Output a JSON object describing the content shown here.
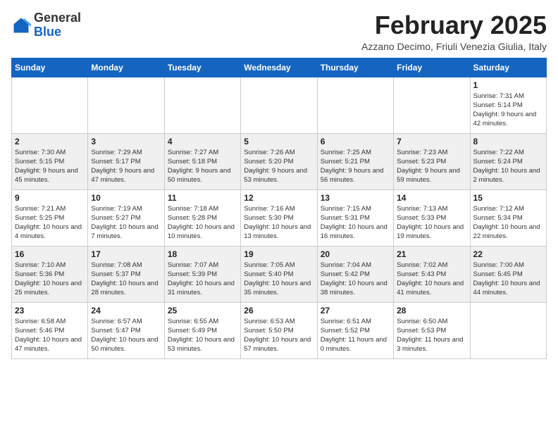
{
  "header": {
    "logo_line1": "General",
    "logo_line2": "Blue",
    "month_year": "February 2025",
    "location": "Azzano Decimo, Friuli Venezia Giulia, Italy"
  },
  "days_of_week": [
    "Sunday",
    "Monday",
    "Tuesday",
    "Wednesday",
    "Thursday",
    "Friday",
    "Saturday"
  ],
  "weeks": [
    [
      {
        "day": "",
        "info": ""
      },
      {
        "day": "",
        "info": ""
      },
      {
        "day": "",
        "info": ""
      },
      {
        "day": "",
        "info": ""
      },
      {
        "day": "",
        "info": ""
      },
      {
        "day": "",
        "info": ""
      },
      {
        "day": "1",
        "info": "Sunrise: 7:31 AM\nSunset: 5:14 PM\nDaylight: 9 hours and 42 minutes."
      }
    ],
    [
      {
        "day": "2",
        "info": "Sunrise: 7:30 AM\nSunset: 5:15 PM\nDaylight: 9 hours and 45 minutes."
      },
      {
        "day": "3",
        "info": "Sunrise: 7:29 AM\nSunset: 5:17 PM\nDaylight: 9 hours and 47 minutes."
      },
      {
        "day": "4",
        "info": "Sunrise: 7:27 AM\nSunset: 5:18 PM\nDaylight: 9 hours and 50 minutes."
      },
      {
        "day": "5",
        "info": "Sunrise: 7:26 AM\nSunset: 5:20 PM\nDaylight: 9 hours and 53 minutes."
      },
      {
        "day": "6",
        "info": "Sunrise: 7:25 AM\nSunset: 5:21 PM\nDaylight: 9 hours and 56 minutes."
      },
      {
        "day": "7",
        "info": "Sunrise: 7:23 AM\nSunset: 5:23 PM\nDaylight: 9 hours and 59 minutes."
      },
      {
        "day": "8",
        "info": "Sunrise: 7:22 AM\nSunset: 5:24 PM\nDaylight: 10 hours and 2 minutes."
      }
    ],
    [
      {
        "day": "9",
        "info": "Sunrise: 7:21 AM\nSunset: 5:25 PM\nDaylight: 10 hours and 4 minutes."
      },
      {
        "day": "10",
        "info": "Sunrise: 7:19 AM\nSunset: 5:27 PM\nDaylight: 10 hours and 7 minutes."
      },
      {
        "day": "11",
        "info": "Sunrise: 7:18 AM\nSunset: 5:28 PM\nDaylight: 10 hours and 10 minutes."
      },
      {
        "day": "12",
        "info": "Sunrise: 7:16 AM\nSunset: 5:30 PM\nDaylight: 10 hours and 13 minutes."
      },
      {
        "day": "13",
        "info": "Sunrise: 7:15 AM\nSunset: 5:31 PM\nDaylight: 10 hours and 16 minutes."
      },
      {
        "day": "14",
        "info": "Sunrise: 7:13 AM\nSunset: 5:33 PM\nDaylight: 10 hours and 19 minutes."
      },
      {
        "day": "15",
        "info": "Sunrise: 7:12 AM\nSunset: 5:34 PM\nDaylight: 10 hours and 22 minutes."
      }
    ],
    [
      {
        "day": "16",
        "info": "Sunrise: 7:10 AM\nSunset: 5:36 PM\nDaylight: 10 hours and 25 minutes."
      },
      {
        "day": "17",
        "info": "Sunrise: 7:08 AM\nSunset: 5:37 PM\nDaylight: 10 hours and 28 minutes."
      },
      {
        "day": "18",
        "info": "Sunrise: 7:07 AM\nSunset: 5:39 PM\nDaylight: 10 hours and 31 minutes."
      },
      {
        "day": "19",
        "info": "Sunrise: 7:05 AM\nSunset: 5:40 PM\nDaylight: 10 hours and 35 minutes."
      },
      {
        "day": "20",
        "info": "Sunrise: 7:04 AM\nSunset: 5:42 PM\nDaylight: 10 hours and 38 minutes."
      },
      {
        "day": "21",
        "info": "Sunrise: 7:02 AM\nSunset: 5:43 PM\nDaylight: 10 hours and 41 minutes."
      },
      {
        "day": "22",
        "info": "Sunrise: 7:00 AM\nSunset: 5:45 PM\nDaylight: 10 hours and 44 minutes."
      }
    ],
    [
      {
        "day": "23",
        "info": "Sunrise: 6:58 AM\nSunset: 5:46 PM\nDaylight: 10 hours and 47 minutes."
      },
      {
        "day": "24",
        "info": "Sunrise: 6:57 AM\nSunset: 5:47 PM\nDaylight: 10 hours and 50 minutes."
      },
      {
        "day": "25",
        "info": "Sunrise: 6:55 AM\nSunset: 5:49 PM\nDaylight: 10 hours and 53 minutes."
      },
      {
        "day": "26",
        "info": "Sunrise: 6:53 AM\nSunset: 5:50 PM\nDaylight: 10 hours and 57 minutes."
      },
      {
        "day": "27",
        "info": "Sunrise: 6:51 AM\nSunset: 5:52 PM\nDaylight: 11 hours and 0 minutes."
      },
      {
        "day": "28",
        "info": "Sunrise: 6:50 AM\nSunset: 5:53 PM\nDaylight: 11 hours and 3 minutes."
      },
      {
        "day": "",
        "info": ""
      }
    ]
  ]
}
